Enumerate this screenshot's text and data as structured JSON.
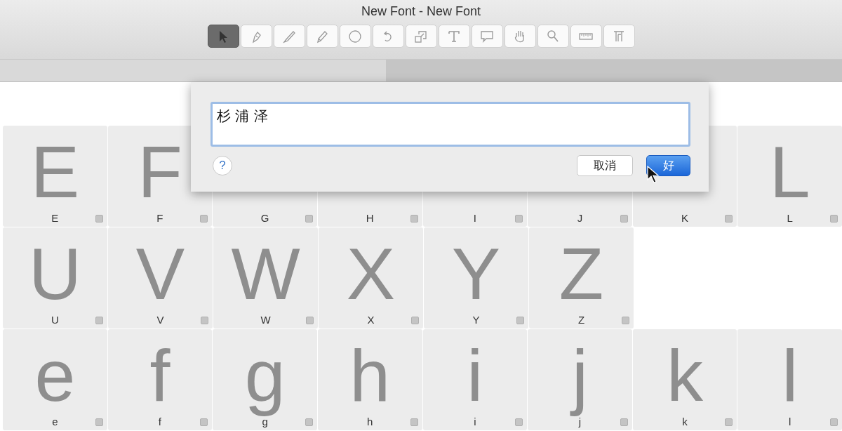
{
  "window": {
    "title": "New Font - New Font"
  },
  "toolbar": [
    {
      "kind": "pointer",
      "selected": true
    },
    {
      "kind": "pen",
      "selected": false
    },
    {
      "kind": "knife",
      "selected": false
    },
    {
      "kind": "pencil",
      "selected": false
    },
    {
      "kind": "ellipse",
      "selected": false
    },
    {
      "kind": "rotate",
      "selected": false
    },
    {
      "kind": "scale",
      "selected": false
    },
    {
      "kind": "text",
      "selected": false
    },
    {
      "kind": "comment",
      "selected": false
    },
    {
      "kind": "hand",
      "selected": false
    },
    {
      "kind": "zoom",
      "selected": false
    },
    {
      "kind": "ruler",
      "selected": false
    },
    {
      "kind": "metrics",
      "selected": false
    }
  ],
  "glyph_rows": [
    [
      {
        "glyph": "E",
        "label": "E"
      },
      {
        "glyph": "F",
        "label": "F"
      },
      {
        "label": "G"
      },
      {
        "label": "H"
      },
      {
        "label": "I"
      },
      {
        "label": "J"
      },
      {
        "label": "K"
      },
      {
        "glyph": "L",
        "label": "L"
      }
    ],
    [
      {
        "glyph": "U",
        "label": "U"
      },
      {
        "glyph": "V",
        "label": "V"
      },
      {
        "glyph": "W",
        "label": "W"
      },
      {
        "glyph": "X",
        "label": "X"
      },
      {
        "glyph": "Y",
        "label": "Y"
      },
      {
        "glyph": "Z",
        "label": "Z"
      }
    ],
    [
      {
        "glyph": "e",
        "label": "e"
      },
      {
        "glyph": "f",
        "label": "f"
      },
      {
        "glyph": "g",
        "label": "g"
      },
      {
        "glyph": "h",
        "label": "h"
      },
      {
        "glyph": "i",
        "label": "i"
      },
      {
        "glyph": "j",
        "label": "j"
      },
      {
        "glyph": "k",
        "label": "k"
      },
      {
        "glyph": "l",
        "label": "l"
      }
    ]
  ],
  "dialog": {
    "value": "杉 浦 泽",
    "help": "?",
    "buttons": [
      {
        "label": "取消",
        "default": false
      },
      {
        "label": "好",
        "default": true
      }
    ]
  }
}
